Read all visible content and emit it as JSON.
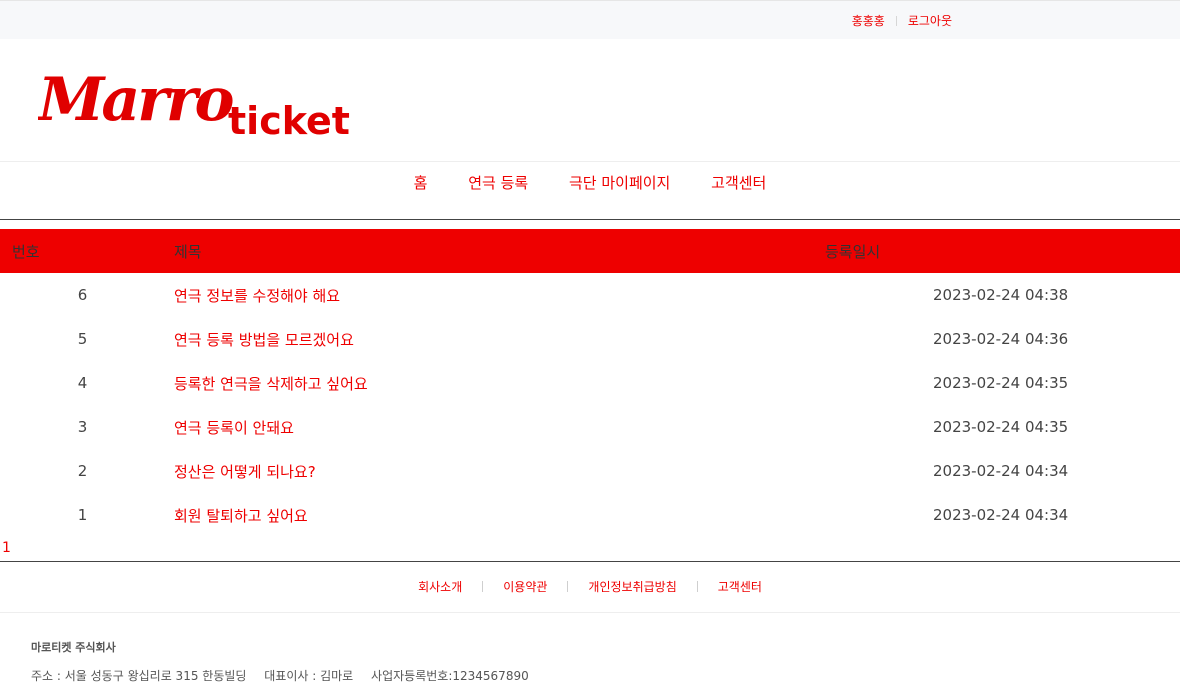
{
  "topbar": {
    "user_name": "홍홍홍",
    "logout": "로그아웃"
  },
  "logo": {
    "script_text": "Marro",
    "text": "ticket",
    "color": "#e00000"
  },
  "nav": {
    "items": [
      "홈",
      "연극 등록",
      "극단 마이페이지",
      "고객센터"
    ]
  },
  "table": {
    "headers": {
      "no": "번호",
      "title": "제목",
      "date": "등록일시"
    },
    "rows": [
      {
        "no": "6",
        "title": "연극 정보를 수정해야 해요",
        "date": "2023-02-24 04:38"
      },
      {
        "no": "5",
        "title": "연극 등록 방법을 모르겠어요",
        "date": "2023-02-24 04:36"
      },
      {
        "no": "4",
        "title": "등록한 연극을 삭제하고 싶어요",
        "date": "2023-02-24 04:35"
      },
      {
        "no": "3",
        "title": "연극 등록이 안돼요",
        "date": "2023-02-24 04:35"
      },
      {
        "no": "2",
        "title": "정산은 어떻게 되나요?",
        "date": "2023-02-24 04:34"
      },
      {
        "no": "1",
        "title": "회원 탈퇴하고 싶어요",
        "date": "2023-02-24 04:34"
      }
    ]
  },
  "pagination": {
    "current": "1"
  },
  "footer": {
    "links": [
      "회사소개",
      "이용약관",
      "개인정보취급방침",
      "고객센터"
    ],
    "company": "마로티켓 주식회사",
    "address": "주소 : 서울 성동구 왕십리로 315 한동빌딩",
    "ceo": "대표이사 : 김마로",
    "biz_no": "사업자등록번호:1234567890"
  },
  "colors": {
    "accent": "#ee0000",
    "topbar_bg": "#f7f8fa"
  }
}
